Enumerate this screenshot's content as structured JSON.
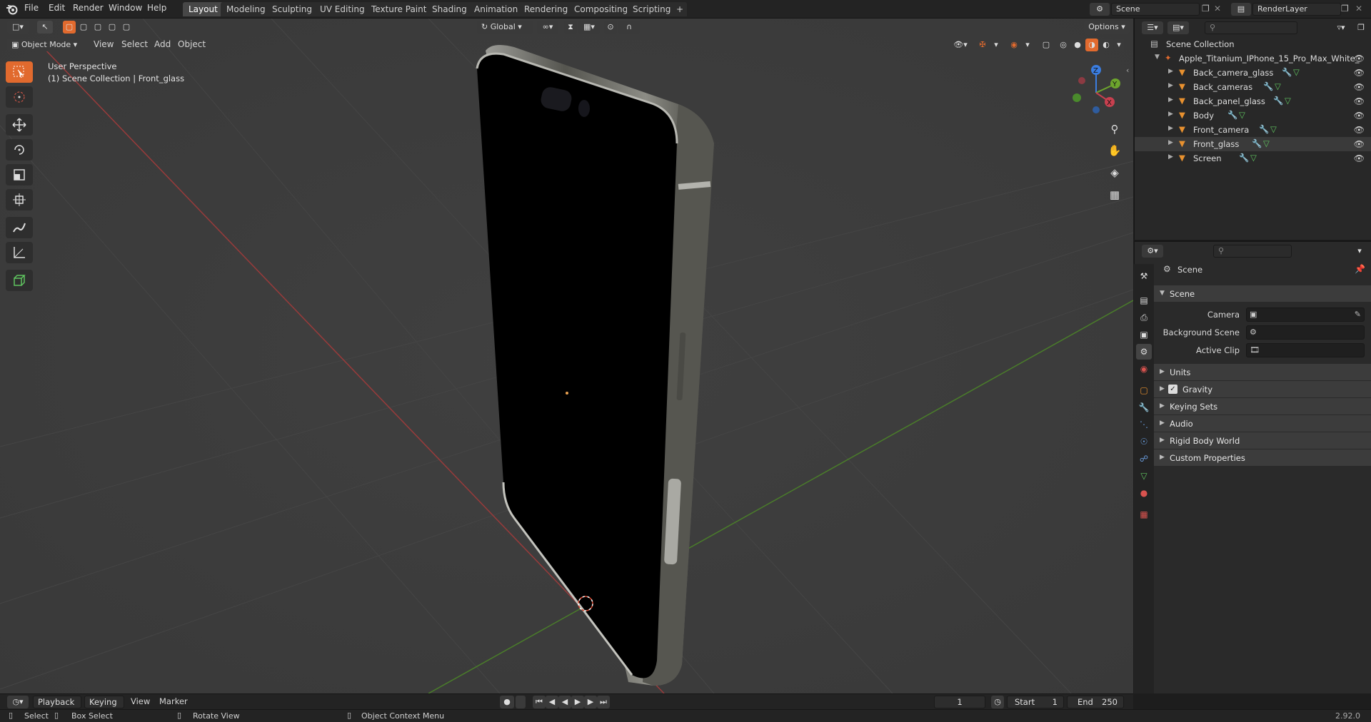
{
  "menu": [
    "File",
    "Edit",
    "Render",
    "Window",
    "Help"
  ],
  "workspaces": [
    "Layout",
    "Modeling",
    "Sculpting",
    "UV Editing",
    "Texture Paint",
    "Shading",
    "Animation",
    "Rendering",
    "Compositing",
    "Scripting"
  ],
  "active_workspace": "Layout",
  "add_workspace_label": "+",
  "scene_name": "Scene",
  "render_layer": "RenderLayer",
  "viewport": {
    "mode": "Object Mode",
    "menus": [
      "View",
      "Select",
      "Add",
      "Object"
    ],
    "orientation": "Global",
    "options_label": "Options",
    "overlay_line1": "User Perspective",
    "overlay_line2": "(1) Scene Collection | Front_glass"
  },
  "gizmo": {
    "z": "Z",
    "y": "Y",
    "x": "X"
  },
  "outliner": {
    "root": "Scene Collection",
    "collection": "Apple_Titanium_IPhone_15_Pro_Max_White_",
    "objects": [
      "Back_camera_glass",
      "Back_cameras",
      "Back_panel_glass",
      "Body",
      "Front_camera",
      "Front_glass",
      "Screen"
    ],
    "selected": "Front_glass"
  },
  "properties": {
    "context": "Scene",
    "section": "Scene",
    "fields": [
      {
        "label": "Camera"
      },
      {
        "label": "Background Scene"
      },
      {
        "label": "Active Clip"
      }
    ],
    "collapsed_sections": [
      "Units",
      "Gravity",
      "Keying Sets",
      "Audio",
      "Rigid Body World",
      "Custom Properties"
    ]
  },
  "timeline": {
    "menus": [
      "Playback",
      "Keying",
      "View",
      "Marker"
    ],
    "current_frame": "1",
    "start_label": "Start",
    "start": "1",
    "end_label": "End",
    "end": "250"
  },
  "status": {
    "select": "Select",
    "box_select": "Box Select",
    "rotate_view": "Rotate View",
    "context_menu": "Object Context Menu",
    "version": "2.92.0"
  },
  "colors": {
    "accent": "#e16a2e",
    "selection": "#334d80",
    "x_axis": "#c8404f",
    "y_axis": "#6da52d",
    "z_axis": "#3b7de0"
  }
}
